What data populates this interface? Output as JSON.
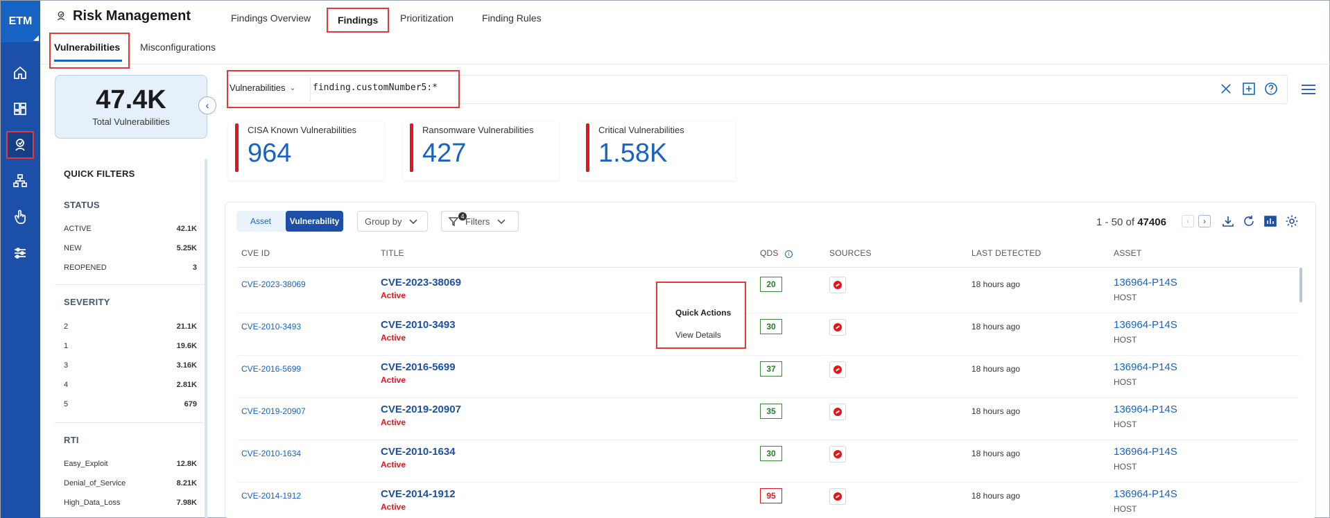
{
  "rail": {
    "logo": "ETM",
    "items": [
      {
        "icon": "home-icon"
      },
      {
        "icon": "dashboard-icon"
      },
      {
        "icon": "risk-management-icon",
        "active": true
      },
      {
        "icon": "asset-hierarchy-icon"
      },
      {
        "icon": "hand-pointer-icon"
      },
      {
        "icon": "sliders-icon"
      }
    ]
  },
  "header": {
    "title": "Risk Management",
    "tabs": [
      "Findings Overview",
      "Findings",
      "Prioritization",
      "Finding Rules"
    ],
    "selected_tab": "Findings"
  },
  "sub_tabs": {
    "items": [
      "Vulnerabilities",
      "Misconfigurations"
    ],
    "selected": "Vulnerabilities"
  },
  "total": {
    "value": "47.4K",
    "label": "Total Vulnerabilities"
  },
  "quick_filters": {
    "title": "QUICK FILTERS",
    "groups": [
      {
        "name": "STATUS",
        "items": [
          {
            "label": "ACTIVE",
            "count": "42.1K"
          },
          {
            "label": "NEW",
            "count": "5.25K"
          },
          {
            "label": "REOPENED",
            "count": "3"
          }
        ]
      },
      {
        "name": "SEVERITY",
        "items": [
          {
            "label": "2",
            "count": "21.1K"
          },
          {
            "label": "1",
            "count": "19.6K"
          },
          {
            "label": "3",
            "count": "3.16K"
          },
          {
            "label": "4",
            "count": "2.81K"
          },
          {
            "label": "5",
            "count": "679"
          }
        ]
      },
      {
        "name": "RTI",
        "items": [
          {
            "label": "Easy_Exploit",
            "count": "12.8K"
          },
          {
            "label": "Denial_of_Service",
            "count": "8.21K"
          },
          {
            "label": "High_Data_Loss",
            "count": "7.98K"
          }
        ]
      }
    ]
  },
  "search": {
    "scope": "Vulnerabilities",
    "query": "finding.customNumber5:*"
  },
  "stats": [
    {
      "label": "CISA Known Vulnerabilities",
      "value": "964"
    },
    {
      "label": "Ransomware Vulnerabilities",
      "value": "427"
    },
    {
      "label": "Critical Vulnerabilities",
      "value": "1.58K"
    }
  ],
  "toolbar": {
    "view_asset": "Asset",
    "view_vulnerability": "Vulnerability",
    "group_by": "Group by",
    "filters": "Filters",
    "filter_count": "4",
    "pager_range": "1 - 50 of",
    "pager_total": "47406"
  },
  "table": {
    "columns": [
      "CVE ID",
      "TITLE",
      "QDS",
      "SOURCES",
      "LAST DETECTED",
      "ASSET"
    ],
    "rows": [
      {
        "cve": "CVE-2023-38069",
        "title": "CVE-2023-38069",
        "status": "Active",
        "qds": "20",
        "detected": "18 hours ago",
        "asset": "136964-P14S",
        "type": "HOST"
      },
      {
        "cve": "CVE-2010-3493",
        "title": "CVE-2010-3493",
        "status": "Active",
        "qds": "30",
        "detected": "18 hours ago",
        "asset": "136964-P14S",
        "type": "HOST"
      },
      {
        "cve": "CVE-2016-5699",
        "title": "CVE-2016-5699",
        "status": "Active",
        "qds": "37",
        "detected": "18 hours ago",
        "asset": "136964-P14S",
        "type": "HOST"
      },
      {
        "cve": "CVE-2019-20907",
        "title": "CVE-2019-20907",
        "status": "Active",
        "qds": "35",
        "detected": "18 hours ago",
        "asset": "136964-P14S",
        "type": "HOST"
      },
      {
        "cve": "CVE-2010-1634",
        "title": "CVE-2010-1634",
        "status": "Active",
        "qds": "30",
        "detected": "18 hours ago",
        "asset": "136964-P14S",
        "type": "HOST"
      },
      {
        "cve": "CVE-2014-1912",
        "title": "CVE-2014-1912",
        "status": "Active",
        "qds": "95",
        "detected": "18 hours ago",
        "asset": "136964-P14S",
        "type": "HOST"
      }
    ]
  },
  "quick_actions": {
    "title": "Quick Actions",
    "item": "View Details"
  },
  "colors": {
    "brand": "#1c4fa8",
    "accent": "#1763c4",
    "critical": "#e5141b",
    "highlight": "#e53935"
  }
}
